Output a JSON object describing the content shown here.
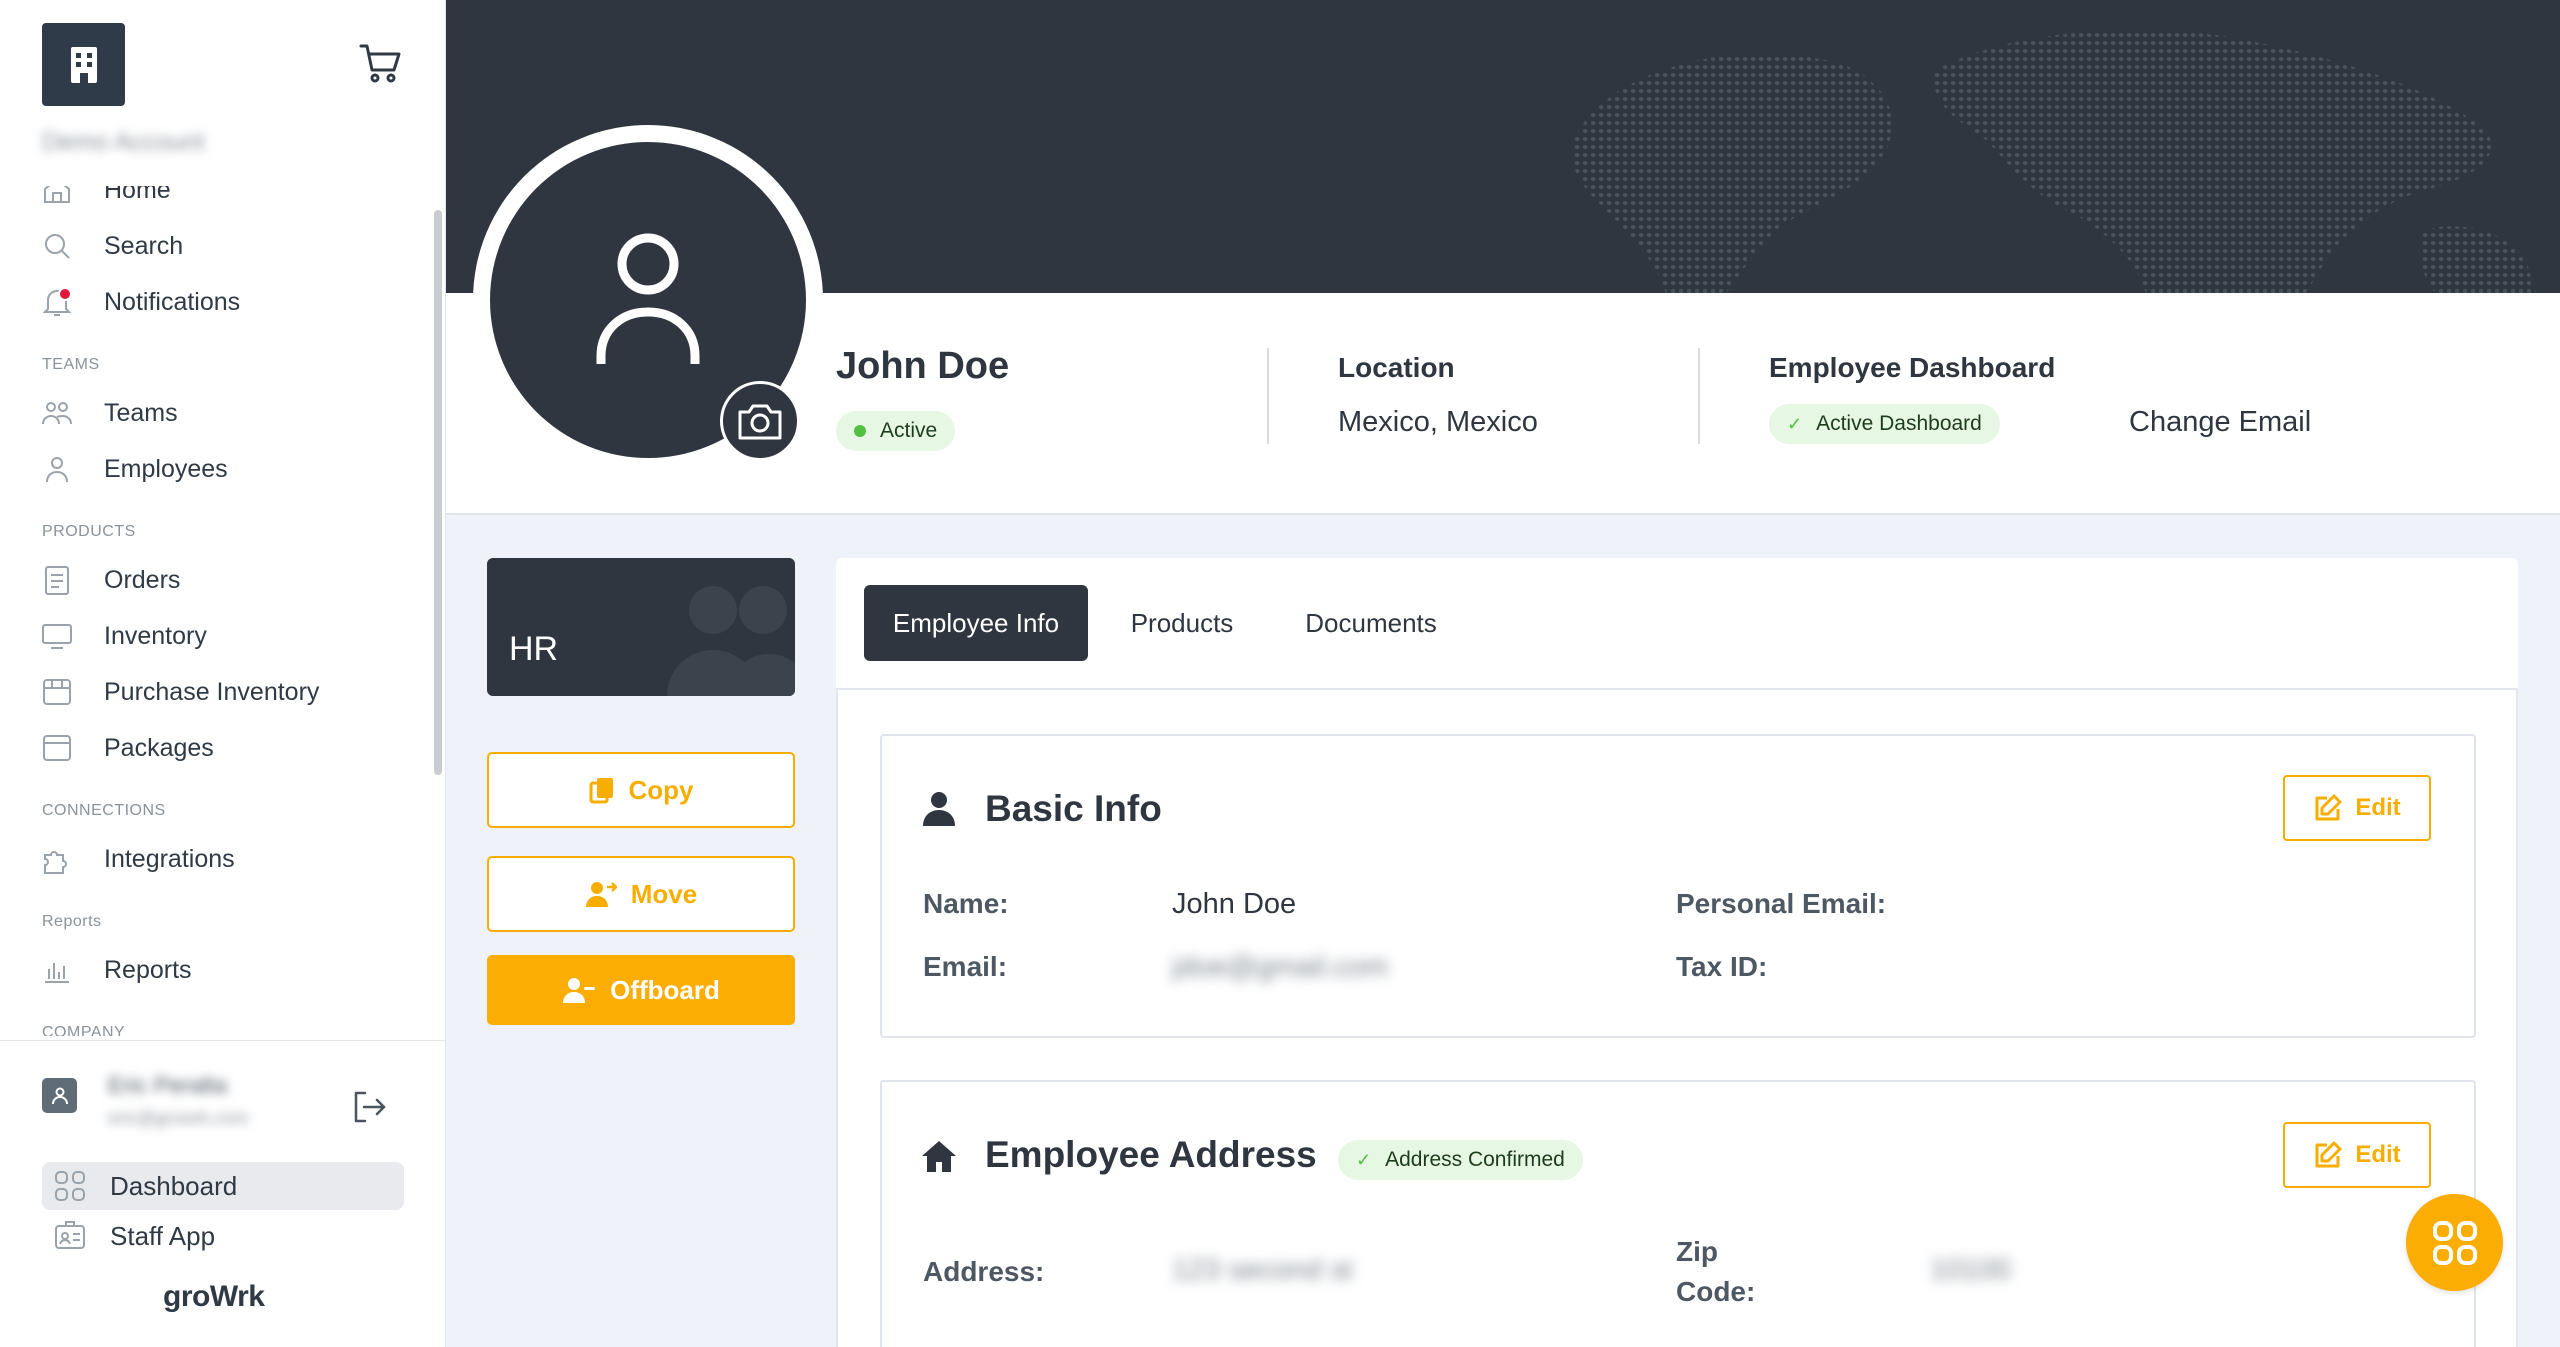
{
  "sidebar": {
    "account_name": "Demo Account",
    "nav": {
      "home": "Home",
      "search": "Search",
      "notifications": "Notifications",
      "teams_section": "TEAMS",
      "teams": "Teams",
      "employees": "Employees",
      "products_section": "PRODUCTS",
      "orders": "Orders",
      "inventory": "Inventory",
      "purchase_inventory": "Purchase Inventory",
      "packages": "Packages",
      "connections_section": "CONNECTIONS",
      "integrations": "Integrations",
      "reports_section": "Reports",
      "reports": "Reports",
      "company_section": "COMPANY"
    },
    "user": {
      "name": "Eric Peralta",
      "email": "eric@growrk.com"
    },
    "bottom": {
      "dashboard": "Dashboard",
      "staff_app": "Staff App"
    },
    "brand": "groWrk",
    "notification_color": "#e3183e"
  },
  "profile": {
    "name": "John Doe",
    "status": "Active",
    "location_label": "Location",
    "location_value": "Mexico, Mexico",
    "dashboard_label": "Employee Dashboard",
    "dashboard_status": "Active Dashboard",
    "change_email": "Change Email"
  },
  "team_card": {
    "name": "HR"
  },
  "actions": {
    "copy": "Copy",
    "move": "Move",
    "offboard": "Offboard"
  },
  "tabs": [
    "Employee Info",
    "Products",
    "Documents"
  ],
  "basic_info": {
    "title": "Basic Info",
    "edit": "Edit",
    "name_label": "Name:",
    "name_value": "John Doe",
    "email_label": "Email:",
    "email_value": "jdoe@gmail.com",
    "personal_email_label": "Personal Email:",
    "tax_id_label": "Tax ID:"
  },
  "address": {
    "title": "Employee Address",
    "badge": "Address Confirmed",
    "edit": "Edit",
    "address_label": "Address:",
    "address_value": "123 second st",
    "zip_label_1": "Zip",
    "zip_label_2": "Code:",
    "zip_value": "10100"
  },
  "colors": {
    "accent": "#fbad04",
    "dark": "#2f363f",
    "success": "#52c041",
    "success_bg": "#e6f7e3"
  }
}
